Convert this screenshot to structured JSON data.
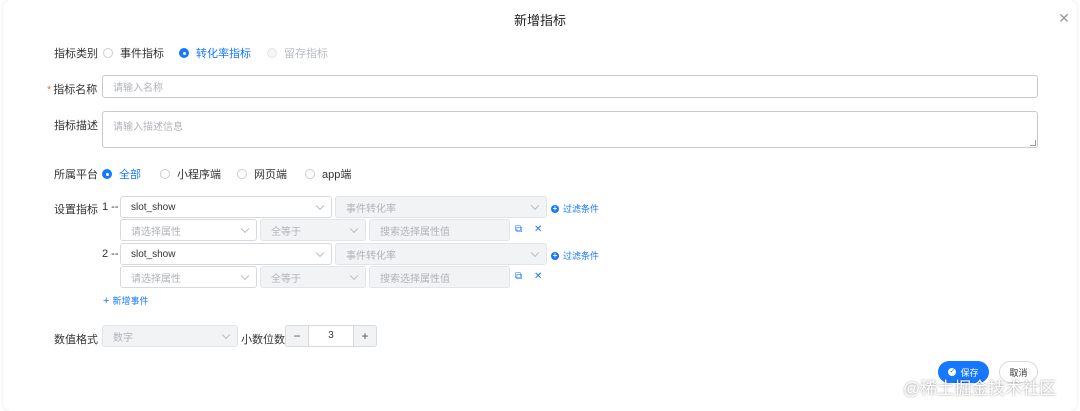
{
  "dialog": {
    "title": "新增指标"
  },
  "type": {
    "label": "指标类别",
    "options": [
      "事件指标",
      "转化率指标",
      "留存指标"
    ],
    "selected": "转化率指标"
  },
  "name": {
    "label": "指标名称",
    "required_mark": "*",
    "placeholder": "请输入名称"
  },
  "desc": {
    "label": "指标描述",
    "placeholder": "请输入描述信息"
  },
  "platform": {
    "label": "所属平台",
    "options": [
      "全部",
      "小程序端",
      "网页端",
      "app端"
    ],
    "selected": "全部"
  },
  "metrics": {
    "label": "设置指标",
    "rows": [
      {
        "index": "1 --",
        "event": "slot_show",
        "calc": "事件转化率",
        "filter_link": "过滤条件",
        "attr_placeholder": "请选择属性",
        "op": "全等于",
        "value_placeholder": "搜索选择属性值"
      },
      {
        "index": "2 --",
        "event": "slot_show",
        "calc": "事件转化率",
        "filter_link": "过滤条件",
        "attr_placeholder": "请选择属性",
        "op": "全等于",
        "value_placeholder": "搜索选择属性值"
      }
    ],
    "add_event": "新增事件"
  },
  "format": {
    "label": "数值格式",
    "type_placeholder": "数字",
    "decimal_label": "小数位数",
    "decimal_value": "3"
  },
  "actions": {
    "save": "保存",
    "cancel": "取消"
  },
  "watermark": "@稀土掘金技术社区",
  "colors": {
    "accent": "#1677ff",
    "required": "#f56c6c"
  }
}
